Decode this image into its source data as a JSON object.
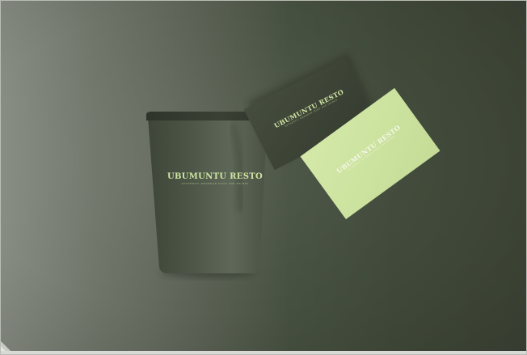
{
  "brand": {
    "name": "UBUMUNTU RESTO",
    "tagline": "AUTHENTIC RWANDAN FOOD AND DRINKS"
  },
  "colors": {
    "background_dark": "#3f4738",
    "background_light": "#888d84",
    "cup_body": "#4a5244",
    "card_dark": "#3c4335",
    "card_light": "#cfe5a2",
    "brand_green": "#cfe5a2"
  }
}
